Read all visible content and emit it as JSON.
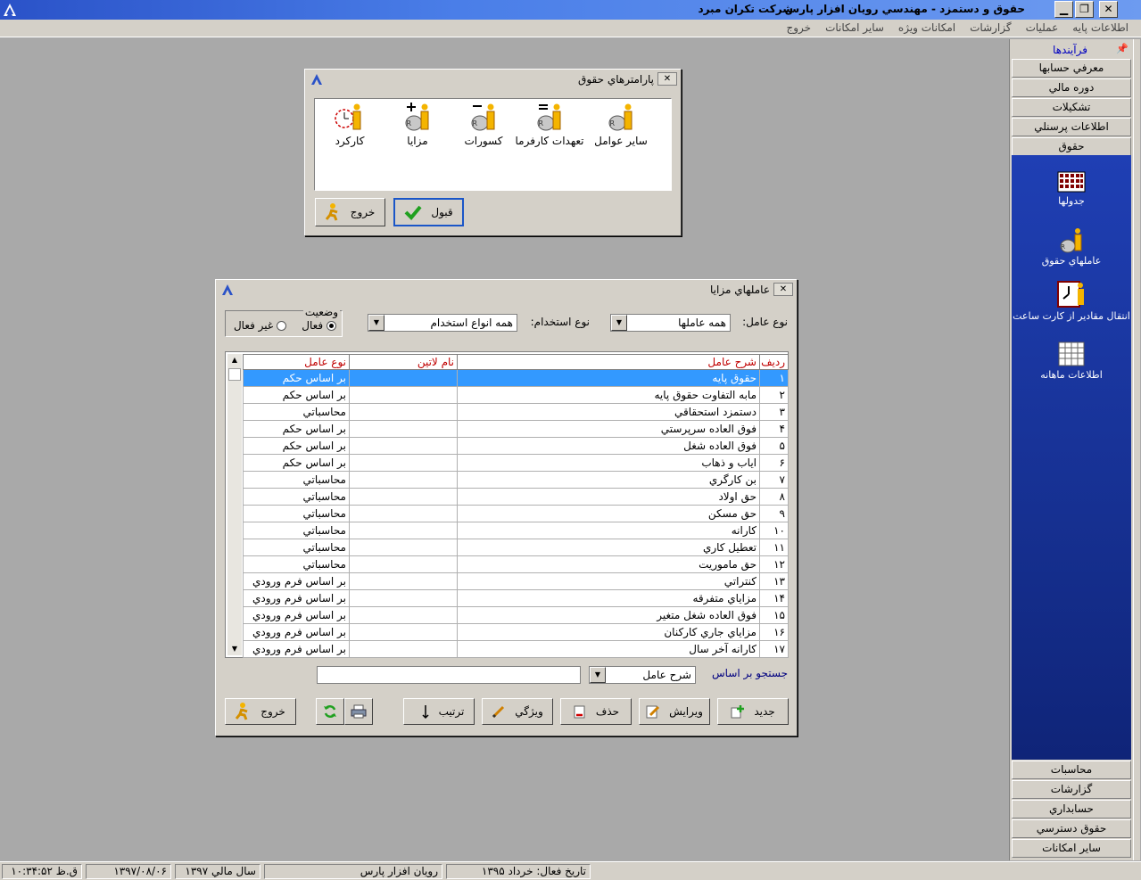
{
  "window": {
    "title": "حقوق و دستمزد - مهندسي رويان افزار پارس",
    "company": "شركت تكران مبرد"
  },
  "menu": [
    "اطلاعات پايه",
    "عمليات",
    "گزارشات",
    "امكانات ويژه",
    "ساير امكانات",
    "خروج"
  ],
  "sidebar": {
    "header": "فرآیندها",
    "top_items": [
      "معرفي حسابها",
      "دوره مالي",
      "تشكيلات",
      "اطلاعات پرسنلي",
      "حقوق"
    ],
    "icons": [
      "جدولها",
      "عاملهاي حقوق",
      "انتقال مقادير از كارت ساعت",
      "اطلاعات ماهانه"
    ],
    "bottom_items": [
      "محاسبات",
      "گزارشات",
      "حسابداري",
      "حقوق دسترسي",
      "ساير امكانات"
    ]
  },
  "params_dialog": {
    "title": "پارامترهاي حقوق",
    "tiles": [
      "ساير عوامل",
      "تعهدات كارفرما",
      "كسورات",
      "مزايا",
      "كاركرد"
    ],
    "ok_label": "قبول",
    "exit_label": "خروج"
  },
  "benefits_dialog": {
    "title": "عاملهاي مزايا",
    "factor_type_label": "نوع عامل:",
    "factor_type_value": "همه عاملها",
    "employment_label": "نوع استخدام:",
    "employment_value": "همه انواع استخدام",
    "status_label": "وضعيت",
    "active_label": "فعال",
    "inactive_label": "غير فعال",
    "columns": [
      "رديف",
      "شرح عامل",
      "نام لاتين",
      "نوع عامل"
    ],
    "rows": [
      [
        "١",
        "حقوق پايه",
        "",
        "بر اساس حكم"
      ],
      [
        "٢",
        "مابه التفاوت حقوق پايه",
        "",
        "بر اساس حكم"
      ],
      [
        "٣",
        "دستمزد استحقاقي",
        "",
        "محاسباتي"
      ],
      [
        "۴",
        "فوق العاده سرپرستي",
        "",
        "بر اساس حكم"
      ],
      [
        "۵",
        "فوق العاده شغل",
        "",
        "بر اساس حكم"
      ],
      [
        "۶",
        "اياب و ذهاب",
        "",
        "بر اساس حكم"
      ],
      [
        "٧",
        "بن كارگري",
        "",
        "محاسباتي"
      ],
      [
        "٨",
        "حق اولاد",
        "",
        "محاسباتي"
      ],
      [
        "٩",
        "حق مسكن",
        "",
        "محاسباتي"
      ],
      [
        "١٠",
        "كارانه",
        "",
        "محاسباتي"
      ],
      [
        "١١",
        "تعطيل كاري",
        "",
        "محاسباتي"
      ],
      [
        "١٢",
        "حق ماموريت",
        "",
        "محاسباتي"
      ],
      [
        "١٣",
        "كنتراتي",
        "",
        "بر اساس فرم ورودي"
      ],
      [
        "١۴",
        "مزاياي متفرقه",
        "",
        "بر اساس فرم ورودي"
      ],
      [
        "١۵",
        "فوق العاده شغل متغير",
        "",
        "بر اساس فرم ورودي"
      ],
      [
        "١۶",
        "مزاياي جاري كاركنان",
        "",
        "بر اساس فرم ورودي"
      ],
      [
        "١٧",
        "كارانه آخر سال",
        "",
        "بر اساس فرم ورودي"
      ]
    ],
    "search_label": "جستجو بر اساس",
    "search_field": "شرح عامل",
    "search_value": "",
    "buttons": {
      "new": "جديد",
      "edit": "ويرايش",
      "delete": "حذف",
      "feature": "ويژگي",
      "sort": "ترتيب",
      "exit": "خروج"
    }
  },
  "status": {
    "active_date_label": "تاريخ فعال:",
    "active_date": "خرداد ١٣٩۵",
    "company": "رويان افزار پارس",
    "fiscal_year": "سال مالي ١٣٩٧",
    "date": "١٣٩٧/٠٨/٠۶",
    "time": "ق.ظ ١٠:٣۴:۵٢"
  }
}
